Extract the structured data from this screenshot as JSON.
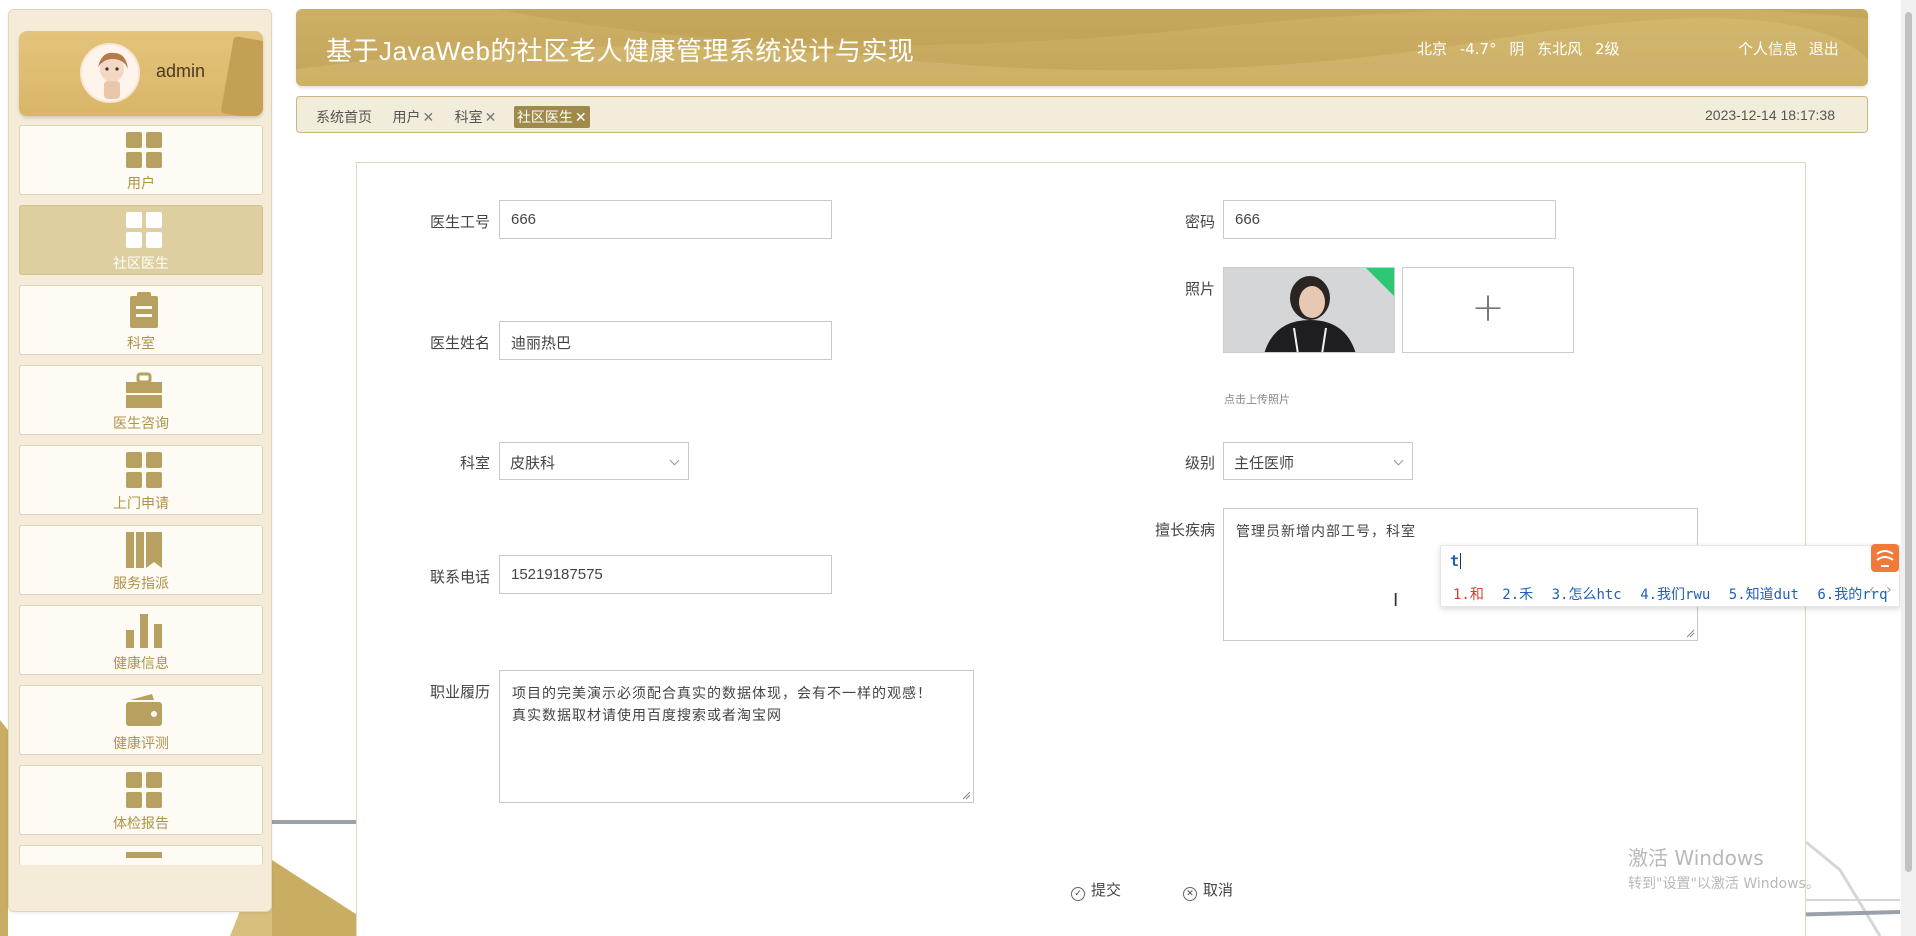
{
  "app": {
    "title": "基于JavaWeb的社区老人健康管理系统设计与实现",
    "weather": {
      "city": "北京",
      "temperature": "-4.7°",
      "condition": "阴",
      "wind": "东北风",
      "level": "2级"
    },
    "links": {
      "profile": "个人信息",
      "logout": "退出"
    }
  },
  "user": {
    "name": "admin"
  },
  "sidebar": {
    "items": [
      {
        "label": "用户",
        "icon": "grid-icon",
        "active": false
      },
      {
        "label": "社区医生",
        "icon": "grid-icon",
        "active": true
      },
      {
        "label": "科室",
        "icon": "clipboard-icon",
        "active": false
      },
      {
        "label": "医生咨询",
        "icon": "briefcase-icon",
        "active": false
      },
      {
        "label": "上门申请",
        "icon": "grid-icon",
        "active": false
      },
      {
        "label": "服务指派",
        "icon": "books-icon",
        "active": false
      },
      {
        "label": "健康信息",
        "icon": "bar-chart-icon",
        "active": false
      },
      {
        "label": "健康评测",
        "icon": "wallet-icon",
        "active": false
      },
      {
        "label": "体检报告",
        "icon": "grid-icon",
        "active": false
      }
    ]
  },
  "tabs": {
    "home": "系统首页",
    "items": [
      {
        "label": "用户",
        "close": "✕"
      },
      {
        "label": "科室",
        "close": "✕"
      },
      {
        "label": "社区医生",
        "close": "✕"
      }
    ],
    "datetime": "2023-12-14 18:17:38"
  },
  "form": {
    "doctor_id": {
      "label": "医生工号",
      "value": "666"
    },
    "password": {
      "label": "密码",
      "value": "666"
    },
    "photo": {
      "label": "照片",
      "hint": "点击上传照片",
      "plus": "+"
    },
    "doctor_name": {
      "label": "医生姓名",
      "value": "迪丽热巴"
    },
    "department": {
      "label": "科室",
      "value": "皮肤科"
    },
    "level": {
      "label": "级别",
      "value": "主任医师"
    },
    "specialty": {
      "label": "擅长疾病",
      "value": "管理员新增内部工号，科室"
    },
    "phone": {
      "label": "联系电话",
      "value": "15219187575"
    },
    "resume": {
      "label": "职业履历",
      "line1": "项目的完美演示必须配合真实的数据体现，会有不一样的观感！",
      "line2": "真实数据取材请使用百度搜索或者淘宝网"
    },
    "submit": "提交",
    "cancel": "取消"
  },
  "ime": {
    "composition": "t",
    "candidates": [
      "1.和",
      "2.禾",
      "3.怎么htc",
      "4.我们rwu",
      "5.知道dut",
      "6.我的rrq"
    ],
    "arrows": "‹ ›"
  },
  "watermark": {
    "line1": "激活 Windows",
    "line2": "转到\"设置\"以激活 Windows。"
  },
  "colors": {
    "primary": "#c2a45a",
    "sidebar_bg": "#f4ecd8",
    "active_tab": "#9f8a4c",
    "menu_label": "#b0934a"
  }
}
